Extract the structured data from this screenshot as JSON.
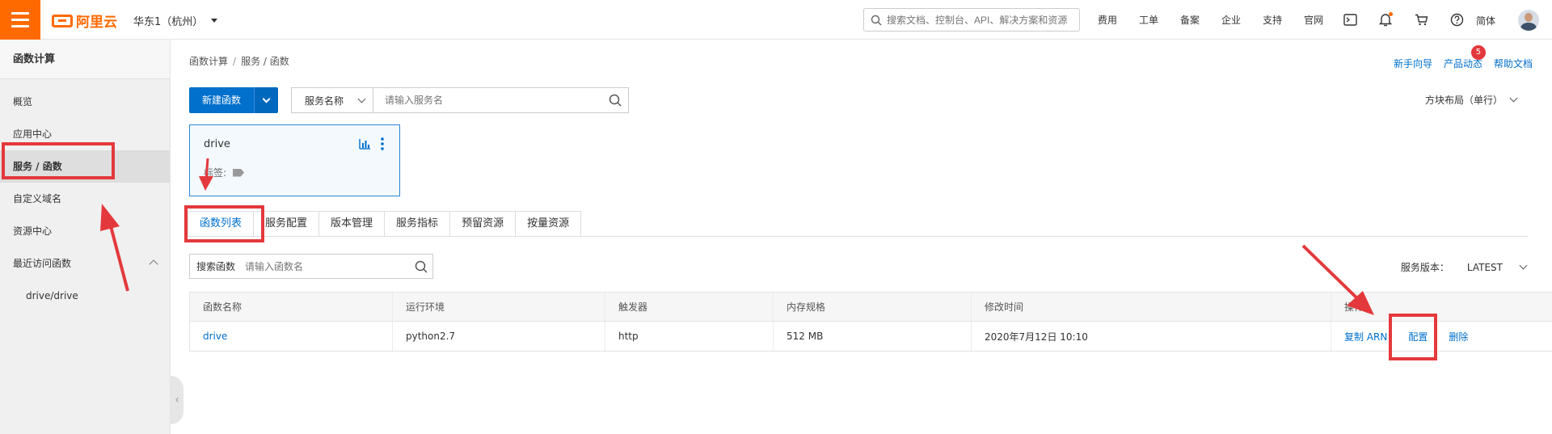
{
  "topbar": {
    "brand": "阿里云",
    "region": "华东1（杭州）",
    "search_placeholder": "搜索文档、控制台、API、解决方案和资源",
    "nav": [
      "费用",
      "工单",
      "备案",
      "企业",
      "支持",
      "官网"
    ],
    "icons": [
      "terminal-icon",
      "bell-icon",
      "cart-icon",
      "help-icon"
    ],
    "lang": "简体"
  },
  "sidebar": {
    "title": "函数计算",
    "items": [
      {
        "label": "概览"
      },
      {
        "label": "应用中心"
      },
      {
        "label": "服务 / 函数",
        "active": true
      },
      {
        "label": "自定义域名"
      },
      {
        "label": "资源中心"
      },
      {
        "label": "最近访问函数"
      }
    ],
    "sub_items": [
      "drive/drive"
    ]
  },
  "breadcrumb": {
    "root": "函数计算",
    "sep": "/",
    "current": "服务 / 函数"
  },
  "help": {
    "guide": "新手向导",
    "news": "产品动态",
    "news_badge": "5",
    "docs": "帮助文档"
  },
  "toolbar": {
    "new_fn": "新建函数",
    "search_type": "服务名称",
    "search_placeholder": "请输入服务名",
    "layout": "方块布局（单行）"
  },
  "service_card": {
    "name": "drive",
    "tags_label": "标签:"
  },
  "tabs": [
    "函数列表",
    "服务配置",
    "版本管理",
    "服务指标",
    "预留资源",
    "按量资源"
  ],
  "fn_search": {
    "label": "搜索函数",
    "placeholder": "请输入函数名"
  },
  "version": {
    "label": "服务版本：",
    "value": "LATEST"
  },
  "table": {
    "headers": [
      "函数名称",
      "运行环境",
      "触发器",
      "内存规格",
      "修改时间",
      "操作"
    ],
    "rows": [
      {
        "name": "drive",
        "runtime": "python2.7",
        "trigger": "http",
        "memory": "512 MB",
        "modified": "2020年7月12日 10:10",
        "ops": [
          "复制 ARN",
          "配置",
          "删除"
        ]
      }
    ]
  },
  "colors": {
    "brand": "#ff6a00",
    "primary": "#0070cc",
    "annotation": "#e4393c"
  }
}
